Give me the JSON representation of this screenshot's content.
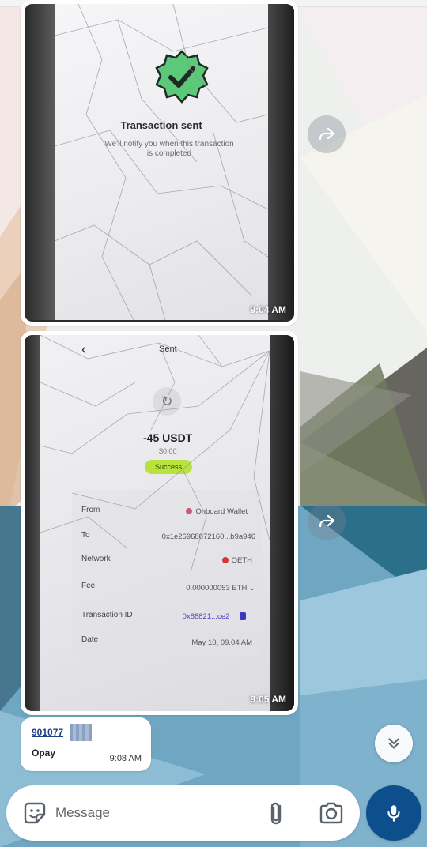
{
  "messages": [
    {
      "type": "image",
      "screen": {
        "title": "Transaction sent",
        "subtitle": "We'll notify you when this transaction is completed"
      },
      "time": "9:04 AM"
    },
    {
      "type": "image",
      "screen": {
        "header": "Sent",
        "back_glyph": "‹",
        "amount": "-45 USDT",
        "usd_value": "$0.00",
        "status": "Success",
        "rows": [
          {
            "label": "From",
            "value": "Onboard Wallet"
          },
          {
            "label": "To",
            "value": "0x1e26968872160...b9a946"
          },
          {
            "label": "Network",
            "value": "OETH"
          },
          {
            "label": "Fee",
            "value": "0.000000053 ETH"
          },
          {
            "label": "Transaction ID",
            "value": "0x88821...ce2"
          },
          {
            "label": "Date",
            "value": "May 10, 09.04 AM"
          }
        ]
      },
      "time": "9:05 AM"
    },
    {
      "type": "text",
      "line1": "901077",
      "line2": "Opay",
      "time": "9:08 AM"
    }
  ],
  "composer": {
    "placeholder": "Message"
  },
  "icons": {
    "forward": "forward-icon",
    "scroll_down": "double-chevron-down-icon",
    "emoji": "sticker-emoji-icon",
    "attach": "paperclip-icon",
    "camera": "camera-icon",
    "mic": "microphone-icon"
  },
  "colors": {
    "mic_button": "#0c4f8c",
    "success_badge": "#b7e33a",
    "link_text": "#4a44b8",
    "verified_badge": "#5cc87a"
  }
}
